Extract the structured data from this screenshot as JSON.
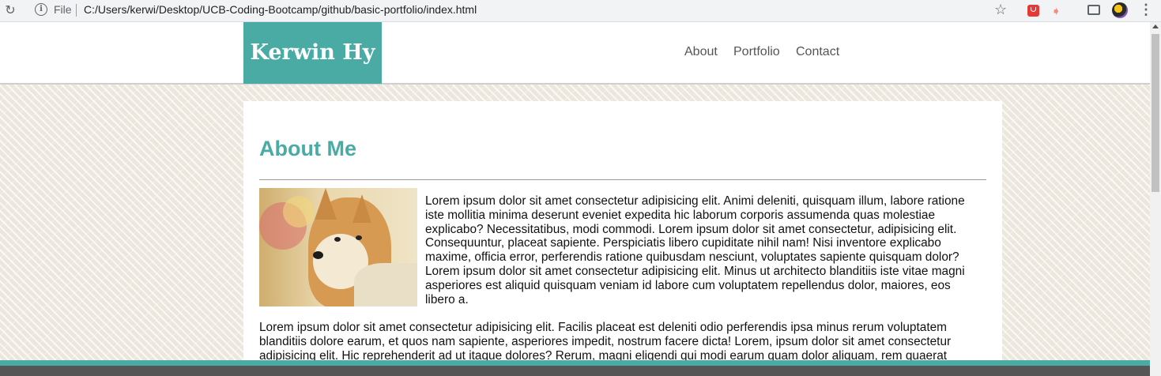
{
  "browser": {
    "file_label": "File",
    "url": "C:/Users/kerwi/Desktop/UCB-Coding-Bootcamp/github/basic-portfolio/index.html",
    "icons": [
      "reload-icon",
      "info-icon",
      "star-icon",
      "pocket-extension-icon",
      "extension-icon",
      "cast-icon",
      "profile-avatar",
      "menu-icon"
    ]
  },
  "site": {
    "logo": "Kerwin Hy",
    "nav": [
      {
        "label": "About"
      },
      {
        "label": "Portfolio"
      },
      {
        "label": "Contact"
      }
    ],
    "colors": {
      "accent": "#4aaba5",
      "footer": "#555555"
    }
  },
  "about": {
    "heading": "About Me",
    "paragraph1": "Lorem ipsum dolor sit amet consectetur adipisicing elit. Animi deleniti, quisquam illum, labore ratione iste mollitia minima deserunt eveniet expedita hic laborum corporis assumenda quas molestiae explicabo? Necessitatibus, modi commodi. Lorem ipsum dolor sit amet consectetur, adipisicing elit. Consequuntur, placeat sapiente. Perspiciatis libero cupiditate nihil nam! Nisi inventore explicabo maxime, officia error, perferendis ratione quibusdam nesciunt, voluptates sapiente quisquam dolor? Lorem ipsum dolor sit amet consectetur adipisicing elit. Minus ut architecto blanditiis iste vitae magni asperiores est aliquid quisquam veniam id labore cum voluptatem repellendus dolor, maiores, eos libero a.",
    "paragraph2": "Lorem ipsum dolor sit amet consectetur adipisicing elit. Facilis placeat est deleniti odio perferendis ipsa minus rerum voluptatem blanditiis dolore earum, et quos nam sapiente, asperiores impedit, nostrum facere dicta! Lorem, ipsum dolor sit amet consectetur adipisicing elit. Hic reprehenderit ad ut itaque dolores? Rerum, magni eligendi qui modi earum quam dolor aliquam, rem quaerat"
  }
}
